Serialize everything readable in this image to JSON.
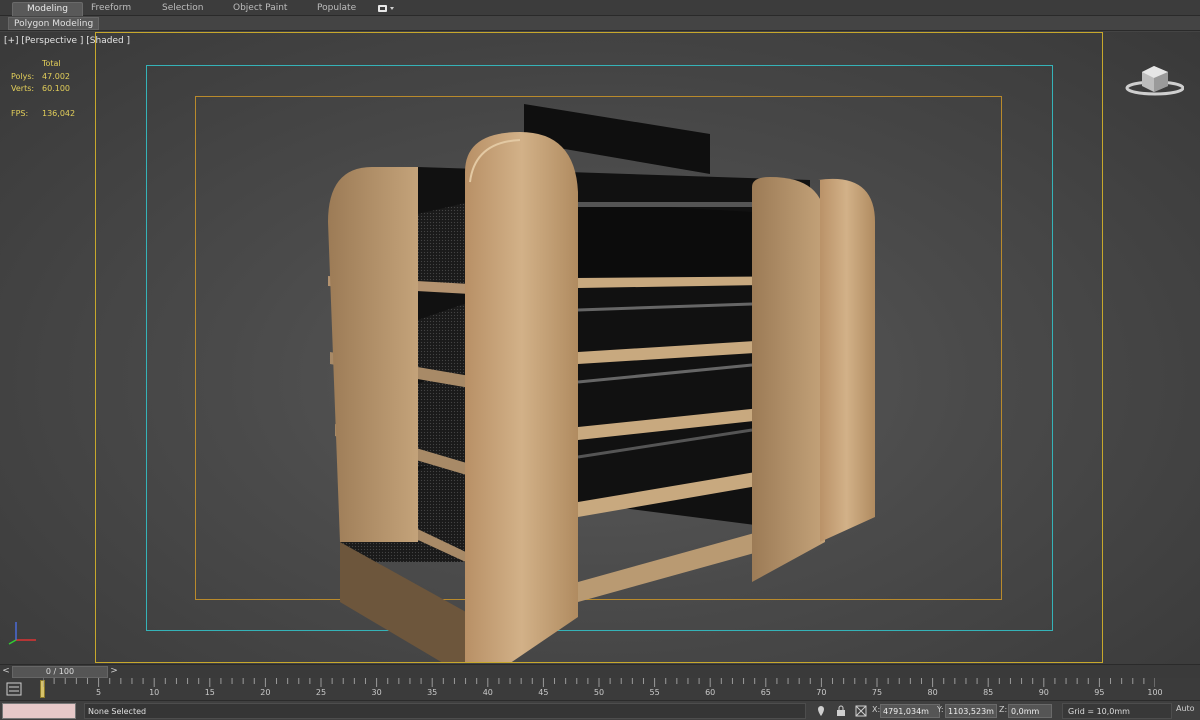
{
  "ribbon": {
    "tabs": [
      {
        "label": "Modeling",
        "active": true
      },
      {
        "label": "Freeform",
        "active": false
      },
      {
        "label": "Selection",
        "active": false
      },
      {
        "label": "Object Paint",
        "active": false
      },
      {
        "label": "Populate",
        "active": false
      }
    ],
    "dropdown_icon": "display-options-icon",
    "panel_label": "Polygon Modeling"
  },
  "viewport": {
    "label": "[+] [Perspective ] [Shaded ]",
    "stats": {
      "header": "Total",
      "polys_label": "Polys:",
      "polys_value": "47.002",
      "verts_label": "Verts:",
      "verts_value": "60.100",
      "fps_label": "FPS:",
      "fps_value": "136,042"
    },
    "viewcube_icon": "viewcube-icon",
    "tripod_icon": "axis-tripod-icon",
    "colors": {
      "frame": "#c7a82c",
      "safe_frame": "#35b3b8",
      "action_safe": "#b98a2c",
      "stats_text": "#e3cf5a",
      "wood": "#c9a77a"
    }
  },
  "timeline": {
    "prev_label": "<",
    "next_label": ">",
    "frame_label": "0 / 100",
    "ticks": [
      "5",
      "10",
      "15",
      "20",
      "25",
      "30",
      "35",
      "40",
      "45",
      "50",
      "55",
      "60",
      "65",
      "70",
      "75",
      "80",
      "85",
      "90",
      "95",
      "100"
    ]
  },
  "status": {
    "selection": "None Selected",
    "x_label": "X:",
    "x_value": "4791,034m",
    "y_label": "Y:",
    "y_value": "1103,523m",
    "z_label": "Z:",
    "z_value": "0,0mm",
    "grid": "Grid = 10,0mm",
    "auto": "Auto"
  }
}
